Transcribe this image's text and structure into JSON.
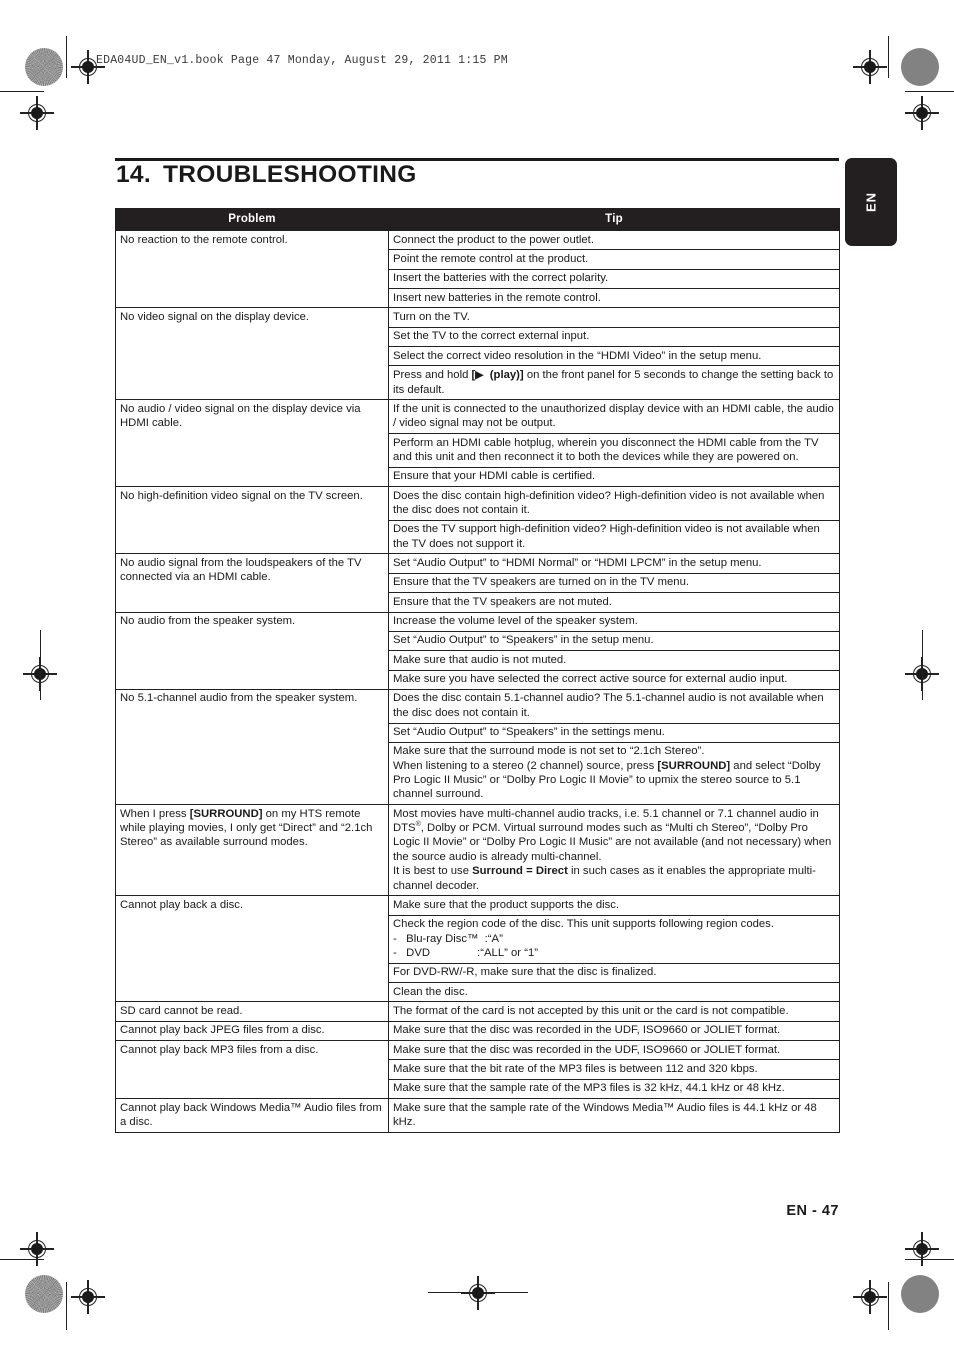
{
  "page": {
    "slug": "EDA04UD_EN_v1.book   Page 47   Monday, August 29, 2011   1:15 PM",
    "chapter_number": "14.",
    "chapter_title": "TROUBLESHOOTING",
    "language_tab": "EN",
    "folio": "EN - 47",
    "ink_color": "#231f20"
  },
  "table": {
    "headers": {
      "problem": "Problem",
      "tip": "Tip"
    },
    "rows": [
      {
        "problem": "No reaction to the remote control.",
        "tips": [
          "Connect the product to the power outlet.",
          "Point the remote control at the product.",
          "Insert the batteries with the correct polarity.",
          "Insert new batteries in the remote control."
        ]
      },
      {
        "problem": "No video signal on the display device.",
        "tips": [
          "Turn on the TV.",
          "Set the TV to the correct external input.",
          "Select the correct video resolution in the “HDMI Video” in the setup menu.",
          "Press and hold [▶ (play)] on the front panel for 5 seconds to change the setting back to its default."
        ],
        "tips_html": [
          null,
          null,
          null,
          "Press and hold <b>[<span class=\"play-glyph\">▶</span>&nbsp; (play)]</b> on the front panel for 5 seconds to change the setting back to its default."
        ]
      },
      {
        "problem": "No audio / video signal on the display device via HDMI cable.",
        "tips": [
          "If the unit is connected to the unauthorized display device with an HDMI cable, the audio / video signal may not be output.",
          "Perform an HDMI cable hotplug, wherein you disconnect the HDMI cable from the TV and this unit and then reconnect it to both the devices while they are powered on.",
          "Ensure that your HDMI cable is certified."
        ]
      },
      {
        "problem": "No high-definition video signal on the TV screen.",
        "tips": [
          "Does the disc contain high-definition video? High-definition video is not available when the disc does not contain it.",
          "Does the TV support high-definition video? High-definition video is not available when the TV does not support it."
        ]
      },
      {
        "problem": "No audio signal from the loudspeakers of the TV connected via an HDMI cable.",
        "tips": [
          "Set “Audio Output” to “HDMI Normal” or “HDMI LPCM” in the setup menu.",
          "Ensure that the TV speakers are turned on in the TV menu.",
          "Ensure that the TV speakers are not muted."
        ]
      },
      {
        "problem": "No audio from the speaker system.",
        "tips": [
          "Increase the volume level of the speaker system.",
          "Set “Audio Output” to “Speakers” in the setup menu.",
          "Make sure that audio is not muted.",
          "Make sure you have selected the correct active source for external audio input."
        ]
      },
      {
        "problem": "No 5.1-channel audio from the speaker system.",
        "tips": [
          "Does the disc contain 5.1-channel audio? The 5.1-channel audio is not available when the disc does not contain it.",
          "Set “Audio Output” to “Speakers” in the settings menu.",
          "Make sure that the surround mode is not set to “2.1ch Stereo”. When listening to a stereo (2 channel) source, press [SURROUND] and select “Dolby Pro Logic II Music” or “Dolby Pro Logic II Movie” to upmix the stereo source to 5.1 channel surround."
        ],
        "tips_html": [
          null,
          null,
          "Make sure that the surround mode is not set to “2.1ch Stereo”.<br>When listening to a stereo (2 channel) source, press <b>[SURROUND]</b> and select “Dolby Pro Logic II Music” or “Dolby Pro Logic II Movie” to upmix the stereo source to 5.1 channel surround."
        ]
      },
      {
        "problem": "When I press [SURROUND] on my HTS remote while playing movies, I only get “Direct” and “2.1ch Stereo” as available surround modes.",
        "problem_html": "When I press <b>[SURROUND]</b> on my HTS remote while playing movies, I only get “Direct” and “2.1ch Stereo” as available surround modes.",
        "tips": [
          "Most movies have multi-channel audio tracks, i.e. 5.1 channel or 7.1 channel audio in DTS®, Dolby or PCM. Virtual surround modes such as “Multi ch Stereo”, “Dolby Pro Logic II Movie” or “Dolby Pro Logic II Music” are not available (and not necessary) when the source audio is already multi-channel. It is best to use Surround = Direct in such cases as it enables the appropriate multi-channel decoder."
        ],
        "tips_html": [
          "Most movies have multi-channel audio tracks, i.e. 5.1 channel or 7.1 channel audio in DTS<sup>®</sup>, Dolby or PCM. Virtual surround modes such as “Multi ch Stereo”, “Dolby Pro Logic II Movie” or “Dolby Pro Logic II Music” are not available (and not necessary) when the source audio is already multi-channel.<br>It is best to use <b>Surround = Direct</b> in such cases as it enables the appropriate multi-channel decoder."
        ]
      },
      {
        "problem": "Cannot play back a disc.",
        "tips": [
          "Make sure that the product supports the disc.",
          "Check the region code of the disc. This unit supports following region codes. -  Blu-ray Disc™ :“A” -  DVD            :“ALL” or “1”",
          "For DVD-RW/-R, make sure that the disc is finalized.",
          "Clean the disc."
        ],
        "tips_html": [
          null,
          "Check the region code of the disc. This unit supports following region codes.<br>-&nbsp;&nbsp; Blu-ray Disc™&nbsp;&nbsp;:“A”<br>-&nbsp;&nbsp; DVD&nbsp;&nbsp;&nbsp;&nbsp;&nbsp;&nbsp;&nbsp;&nbsp;&nbsp;&nbsp;&nbsp;&nbsp;&nbsp;&nbsp;&nbsp;:“ALL” or “1”",
          null,
          null
        ]
      },
      {
        "problem": "SD card cannot be read.",
        "tips": [
          "The format of the card is not accepted by this unit or the card is not compatible."
        ]
      },
      {
        "problem": "Cannot play back JPEG files from a disc.",
        "tips": [
          "Make sure that the disc was recorded in the UDF, ISO9660 or JOLIET format."
        ]
      },
      {
        "problem": "Cannot play back MP3 files from a disc.",
        "tips": [
          "Make sure that the disc was recorded in the UDF, ISO9660 or JOLIET format.",
          "Make sure that the bit rate of the MP3 files is between 112 and 320 kbps.",
          "Make sure that the sample rate of the MP3 files is 32 kHz, 44.1 kHz or 48 kHz."
        ]
      },
      {
        "problem": "Cannot play back Windows Media™ Audio files from a disc.",
        "tips": [
          "Make sure that the sample rate of the Windows Media™ Audio files is 44.1 kHz or 48 kHz."
        ]
      }
    ]
  }
}
